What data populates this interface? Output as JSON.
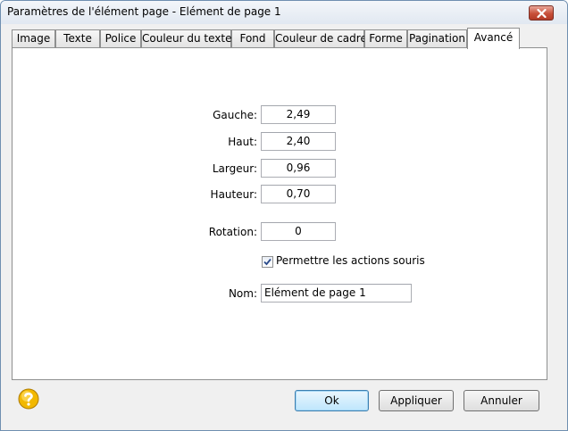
{
  "window": {
    "title": "Paramètres de l'élément page - Elément de page 1"
  },
  "tabs": [
    {
      "label": "Image",
      "active": false
    },
    {
      "label": "Texte",
      "active": false
    },
    {
      "label": "Police",
      "active": false
    },
    {
      "label": "Couleur du texte",
      "active": false
    },
    {
      "label": "Fond",
      "active": false
    },
    {
      "label": "Couleur de cadre",
      "active": false
    },
    {
      "label": "Forme",
      "active": false
    },
    {
      "label": "Pagination",
      "active": false
    },
    {
      "label": "Avancé",
      "active": true
    }
  ],
  "fields": {
    "gauche": {
      "label": "Gauche:",
      "value": "2,49"
    },
    "haut": {
      "label": "Haut:",
      "value": "2,40"
    },
    "largeur": {
      "label": "Largeur:",
      "value": "0,96"
    },
    "hauteur": {
      "label": "Hauteur:",
      "value": "0,70"
    },
    "rotation": {
      "label": "Rotation:",
      "value": "0"
    },
    "nom": {
      "label": "Nom:",
      "value": "Elément de page 1"
    }
  },
  "mouse_actions": {
    "label": "Permettre les actions souris",
    "checked": true
  },
  "buttons": {
    "ok": "Ok",
    "apply": "Appliquer",
    "cancel": "Annuler"
  },
  "icons": {
    "close": "close-icon",
    "help": "help-icon",
    "check": "checkmark-icon"
  },
  "colors": {
    "close_button": "#c8503a",
    "default_button_border": "#3c7fb1",
    "help_icon": "#f2b800"
  }
}
